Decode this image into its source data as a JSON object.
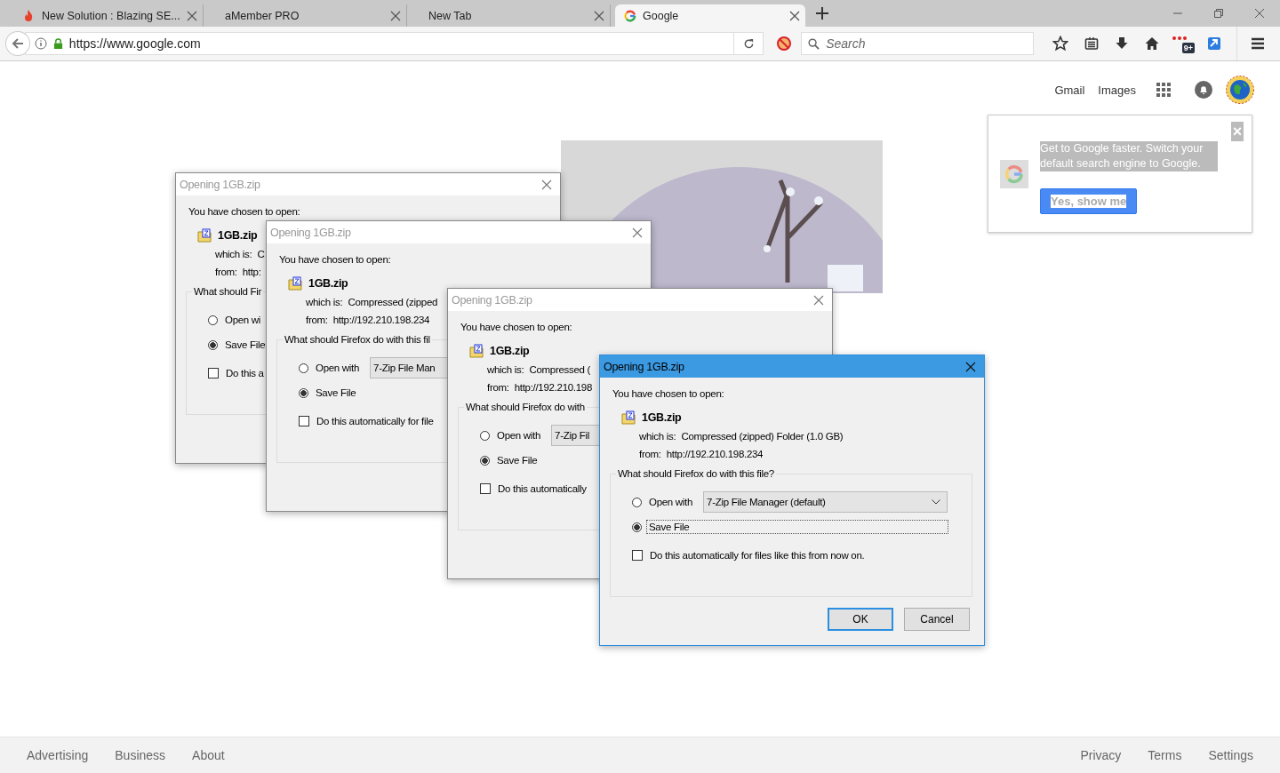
{
  "tabs": [
    {
      "title": "New Solution : Blazing SE...",
      "kind": "flame",
      "selected": false
    },
    {
      "title": "aMember PRO",
      "kind": "plain",
      "selected": false
    },
    {
      "title": "New Tab",
      "kind": "plain",
      "selected": false
    },
    {
      "title": "Google",
      "kind": "google",
      "selected": true
    }
  ],
  "url": "https://www.google.com",
  "search": {
    "placeholder": "Search"
  },
  "extension_badge": "9+",
  "header_links": [
    "Gmail",
    "Images"
  ],
  "promo": {
    "message": "Get to Google faster. Switch your default search engine to Google.",
    "button": "Yes, show me",
    "close": "×"
  },
  "dialogs": [
    {
      "title": "Opening 1GB.zip",
      "active": false,
      "prompt": "You have chosen to open:",
      "filename": "1GB.zip",
      "which_label": "which is:",
      "which_value": "C",
      "from_label": "from:",
      "from_value": "http:",
      "question": "What should Fir",
      "options": [
        {
          "label": "Open wi",
          "selected": false,
          "focused": false
        },
        {
          "label": "Save File",
          "selected": true,
          "focused": false
        }
      ],
      "auto_label": "Do this a",
      "auto_checked": false
    },
    {
      "title": "Opening 1GB.zip",
      "active": false,
      "prompt": "You have chosen to open:",
      "filename": "1GB.zip",
      "which_label": "which is:",
      "which_value": "Compressed (zipped",
      "from_label": "from:",
      "from_value": "http://192.210.198.234",
      "question": "What should Firefox do with this fil",
      "options": [
        {
          "label": "Open with",
          "app": "7-Zip File Man",
          "selected": false,
          "focused": false
        },
        {
          "label": "Save File",
          "selected": true,
          "focused": false
        }
      ],
      "auto_label": "Do this automatically for file",
      "auto_checked": false
    },
    {
      "title": "Opening 1GB.zip",
      "active": false,
      "prompt": "You have chosen to open:",
      "filename": "1GB.zip",
      "which_label": "which is:",
      "which_value": "Compressed (",
      "from_label": "from:",
      "from_value": "http://192.210.198",
      "question": "What should Firefox do with",
      "options": [
        {
          "label": "Open with",
          "app": "7-Zip Fil",
          "selected": false,
          "focused": false
        },
        {
          "label": "Save File",
          "selected": true,
          "focused": false
        }
      ],
      "auto_label": "Do this automatically",
      "auto_checked": false
    },
    {
      "title": "Opening 1GB.zip",
      "active": true,
      "prompt": "You have chosen to open:",
      "filename": "1GB.zip",
      "which_label": "which is:",
      "which_value": "Compressed (zipped) Folder (1.0 GB)",
      "from_label": "from:",
      "from_value": "http://192.210.198.234",
      "question": "What should Firefox do with this file?",
      "options": [
        {
          "label": "Open with",
          "app": "7-Zip File Manager (default)",
          "selected": false,
          "focused": false
        },
        {
          "label": "Save File",
          "selected": true,
          "focused": true
        }
      ],
      "auto_label": "Do this automatically for files like this from now on.",
      "auto_checked": false,
      "buttons": [
        "OK",
        "Cancel"
      ]
    }
  ],
  "footer_left": [
    "Advertising",
    "Business",
    "About"
  ],
  "footer_right": [
    "Privacy",
    "Terms",
    "Settings"
  ]
}
